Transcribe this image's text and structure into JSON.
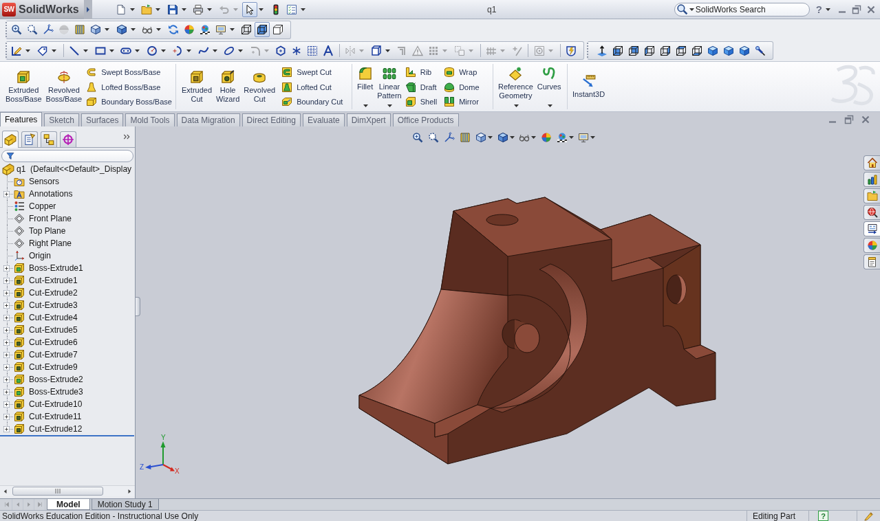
{
  "title_bar": {
    "logo": {
      "badge": "SW",
      "name": "SolidWorks"
    },
    "quick_access": [
      {
        "kind": "page",
        "menu": true,
        "disabled": false,
        "pressed": false
      },
      {
        "kind": "folder",
        "menu": true,
        "disabled": false,
        "pressed": false
      },
      {
        "kind": "floppy",
        "menu": true,
        "disabled": false,
        "pressed": false
      },
      {
        "kind": "printer",
        "menu": true,
        "disabled": false,
        "pressed": false
      },
      {
        "kind": "undo",
        "menu": true,
        "disabled": true,
        "pressed": false
      },
      {
        "kind": "cursor",
        "menu": true,
        "disabled": false,
        "pressed": true
      },
      {
        "kind": "traffic",
        "menu": false,
        "disabled": false,
        "pressed": false
      },
      {
        "kind": "checklist",
        "menu": true,
        "disabled": false,
        "pressed": false
      }
    ],
    "title": "q1",
    "search": {
      "placeholder": "SolidWorks Search"
    },
    "help": "?"
  },
  "view_toolbar": [
    {
      "kind": "zoom",
      "menu": false,
      "disabled": false,
      "pressed": false
    },
    {
      "kind": "zoomarea",
      "menu": false,
      "disabled": false,
      "pressed": false
    },
    {
      "kind": "prevview",
      "menu": false,
      "disabled": false,
      "pressed": false
    },
    {
      "kind": "section",
      "menu": false,
      "disabled": true,
      "pressed": false
    },
    {
      "kind": "film",
      "menu": false,
      "disabled": false,
      "pressed": false
    },
    {
      "kind": "orient",
      "menu": true,
      "disabled": false,
      "pressed": false
    },
    {
      "kind": "display",
      "menu": true,
      "disabled": false,
      "pressed": false
    },
    {
      "kind": "glasses",
      "menu": true,
      "disabled": false,
      "pressed": false
    },
    {
      "kind": "refresh",
      "menu": false,
      "disabled": false,
      "pressed": false
    },
    {
      "kind": "appearance",
      "menu": false,
      "disabled": false,
      "pressed": false
    },
    {
      "kind": "scene",
      "menu": false,
      "disabled": false,
      "pressed": false
    },
    {
      "kind": "monitor",
      "menu": true,
      "disabled": false,
      "pressed": false
    },
    {
      "kind": "wire",
      "menu": false,
      "disabled": false,
      "pressed": false
    },
    {
      "kind": "shaded",
      "menu": false,
      "disabled": false,
      "pressed": true
    },
    {
      "kind": "outline",
      "menu": false,
      "disabled": false,
      "pressed": false
    }
  ],
  "sketch_toolbar": [
    [
      {
        "kind": "sketch",
        "menu": true,
        "disabled": false
      },
      {
        "kind": "dimension",
        "menu": true,
        "disabled": false
      }
    ],
    [
      {
        "kind": "line",
        "menu": true,
        "disabled": false
      },
      {
        "kind": "rect",
        "menu": true,
        "disabled": false
      },
      {
        "kind": "slot",
        "menu": true,
        "disabled": false
      },
      {
        "kind": "circle",
        "menu": true,
        "disabled": false
      },
      {
        "kind": "arc",
        "menu": true,
        "disabled": false
      },
      {
        "kind": "spline",
        "menu": true,
        "disabled": false
      },
      {
        "kind": "ellipse",
        "menu": true,
        "disabled": false
      },
      {
        "kind": "corner",
        "menu": true,
        "disabled": true
      },
      {
        "kind": "polygon",
        "menu": false,
        "disabled": false
      },
      {
        "kind": "point",
        "menu": false,
        "disabled": false
      },
      {
        "kind": "grid",
        "menu": false,
        "disabled": false
      },
      {
        "kind": "letter",
        "menu": false,
        "disabled": false
      }
    ],
    [
      {
        "kind": "mirror",
        "menu": true,
        "disabled": true
      },
      {
        "kind": "offset",
        "menu": true,
        "disabled": false
      },
      {
        "kind": "trim",
        "menu": false,
        "disabled": true
      },
      {
        "kind": "warning",
        "menu": false,
        "disabled": true
      },
      {
        "kind": "dotgrid",
        "menu": true,
        "disabled": true
      },
      {
        "kind": "move",
        "menu": true,
        "disabled": true
      }
    ],
    [
      {
        "kind": "relations",
        "menu": true,
        "disabled": true
      },
      {
        "kind": "addrel",
        "menu": false,
        "disabled": true
      }
    ],
    [
      {
        "kind": "snaps",
        "menu": true,
        "disabled": true
      }
    ],
    [
      {
        "kind": "rapid",
        "menu": false,
        "disabled": false
      }
    ]
  ],
  "standard_views_toolbar": [
    {
      "kind": "normal"
    },
    {
      "kind": "front"
    },
    {
      "kind": "back"
    },
    {
      "kind": "left"
    },
    {
      "kind": "right"
    },
    {
      "kind": "top"
    },
    {
      "kind": "bottom"
    },
    {
      "kind": "iso"
    },
    {
      "kind": "trimetric"
    },
    {
      "kind": "dimetric"
    },
    {
      "kind": "probe"
    }
  ],
  "command_manager": {
    "groups": [
      {
        "large": [
          {
            "label": "Extruded\nBoss/Base",
            "kind": "extrude",
            "menu": false
          },
          {
            "label": "Revolved\nBoss/Base",
            "kind": "revolve",
            "menu": false
          }
        ],
        "small": [
          [
            {
              "label": "Swept Boss/Base",
              "kind": "sweep"
            },
            {
              "label": "Lofted Boss/Base",
              "kind": "loft"
            },
            {
              "label": "Boundary Boss/Base",
              "kind": "boundary"
            }
          ]
        ]
      },
      {
        "large": [
          {
            "label": "Extruded\nCut",
            "kind": "cutextrude",
            "menu": false
          },
          {
            "label": "Hole\nWizard",
            "kind": "hole",
            "menu": false
          },
          {
            "label": "Revolved\nCut",
            "kind": "cutrevolve",
            "menu": false
          }
        ],
        "small": [
          [
            {
              "label": "Swept Cut",
              "kind": "cutsweep"
            },
            {
              "label": "Lofted Cut",
              "kind": "cutloft"
            },
            {
              "label": "Boundary Cut",
              "kind": "cutboundary"
            }
          ]
        ]
      },
      {
        "large": [
          {
            "label": "Fillet",
            "kind": "fillet",
            "menu": true
          },
          {
            "label": "Linear\nPattern",
            "kind": "pattern",
            "menu": true
          }
        ],
        "small": [
          [
            {
              "label": "Rib",
              "kind": "rib"
            },
            {
              "label": "Draft",
              "kind": "draft"
            },
            {
              "label": "Shell",
              "kind": "shell"
            }
          ],
          [
            {
              "label": "Wrap",
              "kind": "wrap"
            },
            {
              "label": "Dome",
              "kind": "dome"
            },
            {
              "label": "Mirror",
              "kind": "mirrorfeature"
            }
          ]
        ]
      },
      {
        "large": [
          {
            "label": "Reference\nGeometry",
            "kind": "refgeom",
            "menu": true
          },
          {
            "label": "Curves",
            "kind": "curves",
            "menu": true
          }
        ]
      },
      {
        "large": [
          {
            "label": "Instant3D",
            "kind": "instant3d",
            "menu": false
          }
        ]
      }
    ]
  },
  "tabs": [
    {
      "label": "Features",
      "selected": true
    },
    {
      "label": "Sketch",
      "selected": false
    },
    {
      "label": "Surfaces",
      "selected": false
    },
    {
      "label": "Mold Tools",
      "selected": false
    },
    {
      "label": "Data Migration",
      "selected": false
    },
    {
      "label": "Direct Editing",
      "selected": false
    },
    {
      "label": "Evaluate",
      "selected": false
    },
    {
      "label": "DimXpert",
      "selected": false
    },
    {
      "label": "Office Products",
      "selected": false
    }
  ],
  "feature_manager": {
    "panel_tabs": [
      {
        "kind": "tree",
        "selected": true
      },
      {
        "kind": "property",
        "selected": false
      },
      {
        "kind": "config",
        "selected": false
      },
      {
        "kind": "dimxpert",
        "selected": false
      }
    ],
    "tree": {
      "label": "q1  (Default<<Default>_Display",
      "kind": "part",
      "children": [
        {
          "label": "Sensors",
          "kind": "sensor",
          "expandable": false
        },
        {
          "label": "Annotations",
          "kind": "annotation",
          "expandable": true
        },
        {
          "label": "Copper",
          "kind": "material",
          "expandable": false
        },
        {
          "label": "Front Plane",
          "kind": "plane",
          "expandable": false
        },
        {
          "label": "Top Plane",
          "kind": "plane",
          "expandable": false
        },
        {
          "label": "Right Plane",
          "kind": "plane",
          "expandable": false
        },
        {
          "label": "Origin",
          "kind": "origin",
          "expandable": false
        },
        {
          "label": "Boss-Extrude1",
          "kind": "boss",
          "expandable": true
        },
        {
          "label": "Cut-Extrude1",
          "kind": "cut",
          "expandable": true
        },
        {
          "label": "Cut-Extrude2",
          "kind": "cut",
          "expandable": true
        },
        {
          "label": "Cut-Extrude3",
          "kind": "cut",
          "expandable": true
        },
        {
          "label": "Cut-Extrude4",
          "kind": "cut",
          "expandable": true
        },
        {
          "label": "Cut-Extrude5",
          "kind": "cut",
          "expandable": true
        },
        {
          "label": "Cut-Extrude6",
          "kind": "cut",
          "expandable": true
        },
        {
          "label": "Cut-Extrude7",
          "kind": "cut",
          "expandable": true
        },
        {
          "label": "Cut-Extrude9",
          "kind": "cut",
          "expandable": true
        },
        {
          "label": "Boss-Extrude2",
          "kind": "boss",
          "expandable": true
        },
        {
          "label": "Boss-Extrude3",
          "kind": "boss",
          "expandable": true
        },
        {
          "label": "Cut-Extrude10",
          "kind": "cut",
          "expandable": true
        },
        {
          "label": "Cut-Extrude11",
          "kind": "cut",
          "expandable": true
        },
        {
          "label": "Cut-Extrude12",
          "kind": "cut",
          "expandable": true
        }
      ]
    }
  },
  "graphics_area": {
    "heads_up_toolbar": [
      {
        "kind": "zoom",
        "menu": false
      },
      {
        "kind": "zoomarea",
        "menu": false
      },
      {
        "kind": "prevview",
        "menu": false
      },
      {
        "kind": "film",
        "menu": false
      },
      {
        "kind": "orient",
        "menu": true
      },
      {
        "kind": "display",
        "menu": true
      },
      {
        "kind": "glasses",
        "menu": true
      },
      {
        "kind": "appearance",
        "menu": false
      },
      {
        "kind": "scene",
        "menu": true
      },
      {
        "kind": "monitor",
        "menu": true
      }
    ],
    "task_pane": [
      {
        "kind": "home",
        "selected": false
      },
      {
        "kind": "library",
        "selected": false
      },
      {
        "kind": "folder",
        "selected": false
      },
      {
        "kind": "globe",
        "selected": false
      },
      {
        "kind": "form",
        "selected": true
      },
      {
        "kind": "appearance",
        "selected": false
      },
      {
        "kind": "notepad",
        "selected": false
      }
    ],
    "triad": {
      "y": "Y",
      "z": "Z",
      "x": "X"
    }
  },
  "model_tabs": {
    "scroll_disabled": true,
    "tabs": [
      {
        "label": "Model",
        "selected": true
      },
      {
        "label": "Motion Study 1",
        "selected": false
      }
    ]
  },
  "status_bar": {
    "message": "SolidWorks Education Edition - Instructional Use Only",
    "mode": "Editing Part",
    "help": "?"
  }
}
